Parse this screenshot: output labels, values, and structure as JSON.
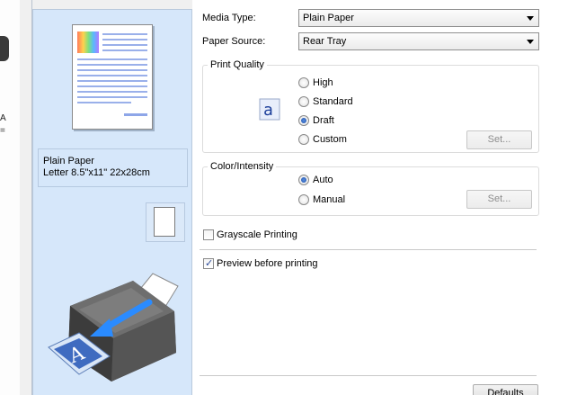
{
  "background": {
    "text_a": "A",
    "text_eq": "="
  },
  "preview": {
    "paper_type": "Plain Paper",
    "paper_size": "Letter 8.5\"x11\" 22x28cm"
  },
  "media_type": {
    "label": "Media Type:",
    "value": "Plain Paper"
  },
  "paper_source": {
    "label": "Paper Source:",
    "value": "Rear Tray"
  },
  "print_quality": {
    "title": "Print Quality",
    "options": [
      "High",
      "Standard",
      "Draft",
      "Custom"
    ],
    "selected": "Draft",
    "set_label": "Set..."
  },
  "color_intensity": {
    "title": "Color/Intensity",
    "options": [
      "Auto",
      "Manual"
    ],
    "selected": "Auto",
    "set_label": "Set..."
  },
  "grayscale": {
    "label": "Grayscale Printing",
    "checked": false
  },
  "preview_before": {
    "label": "Preview before printing",
    "checked": true
  },
  "defaults_label": "Defaults",
  "colors": {
    "panel": "#d6e7fa",
    "accent": "#1b4da8"
  }
}
